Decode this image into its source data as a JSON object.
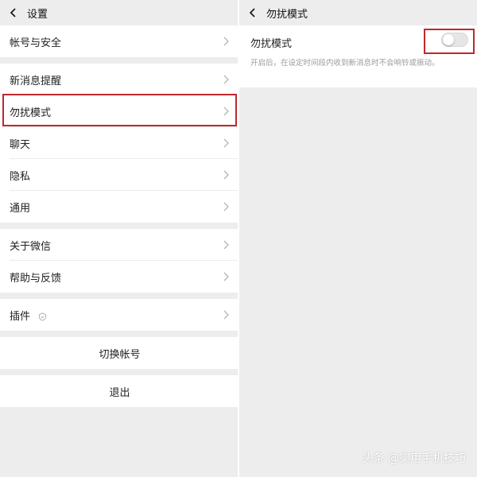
{
  "left": {
    "header_title": "设置",
    "groups": [
      {
        "items": [
          "帐号与安全"
        ]
      },
      {
        "items": [
          "新消息提醒",
          "勿扰模式",
          "聊天",
          "隐私",
          "通用"
        ]
      },
      {
        "items": [
          "关于微信",
          "帮助与反馈"
        ]
      },
      {
        "items": [
          "插件"
        ]
      }
    ],
    "switch_account": "切换帐号",
    "logout": "退出"
  },
  "right": {
    "header_title": "勿扰模式",
    "dnd_label": "勿扰模式",
    "dnd_description": "开启后，在设定时间段内收到新消息时不会响铃或振动。",
    "dnd_enabled": false
  },
  "watermark": "头条 @实用手机技巧",
  "colors": {
    "highlight": "#c0282d",
    "background": "#ededed"
  }
}
